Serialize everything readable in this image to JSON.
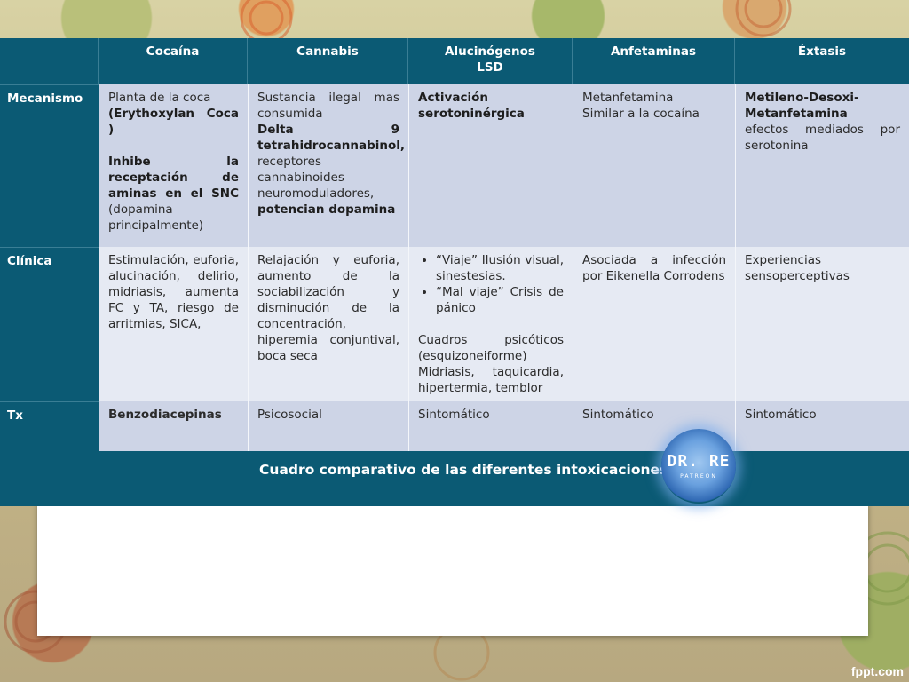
{
  "header": {
    "columns": [
      "",
      "Cocaína",
      "Cannabis",
      "Alucinógenos",
      "Anfetaminas",
      "Éxtasis"
    ],
    "alucinogenos_sub": "LSD"
  },
  "rows": {
    "mecanismo": {
      "label": "Mecanismo",
      "cocaina": {
        "l1": "Planta de la coca",
        "l2": "(Erythoxylan Coca )",
        "l3": "Inhibe la receptación de aminas en el SNC",
        "l4": "(dopamina principalmente)"
      },
      "cannabis": {
        "l1": "Sustancia ilegal mas consumida",
        "l2": "Delta 9 tetrahidrocannabinol,",
        "l3": "receptores cannabinoides neuromoduladores,",
        "l4": "potencian dopamina"
      },
      "alucinogenos": {
        "l1": "Activación serotoninérgica"
      },
      "anfetaminas": {
        "l1": "Metanfetamina",
        "l2": "Similar a la cocaína"
      },
      "extasis": {
        "l1": "Metileno-Desoxi-Metanfetamina",
        "l2": "efectos mediados por serotonina"
      }
    },
    "clinica": {
      "label": "Clínica",
      "cocaina": "Estimulación, euforia, alucinación, delirio, midriasis, aumenta FC y TA, riesgo de arritmias, SICA,",
      "cannabis": "Relajación y euforia, aumento de la sociabilización y disminución de la concentración, hiperemia conjuntival, boca seca",
      "alucinogenos": {
        "bullet1": "“Viaje” Ilusión visual, sinestesias.",
        "bullet2": "“Mal viaje” Crisis de pánico",
        "p1": "Cuadros psicóticos (esquizoneiforme)",
        "p2": "Midriasis, taquicardia, hipertermia, temblor"
      },
      "anfetaminas": "Asociada a infección por Eikenella Corrodens",
      "extasis": "Experiencias sensoperceptivas"
    },
    "tx": {
      "label": "Tx",
      "cocaina": "Benzodiacepinas",
      "cannabis": "Psicosocial",
      "alucinogenos": "Sintomático",
      "anfetaminas": "Sintomático",
      "extasis": "Sintomático"
    }
  },
  "footer": {
    "title": "Cuadro comparativo de las diferentes intoxicaciones",
    "logo_main": "DR. RE",
    "logo_sub": "PATREON"
  },
  "watermark": "fppt.com",
  "colors": {
    "header_bg": "#0b5a74",
    "row_dark": "#cdd4e6",
    "row_light": "#e6eaf3"
  }
}
